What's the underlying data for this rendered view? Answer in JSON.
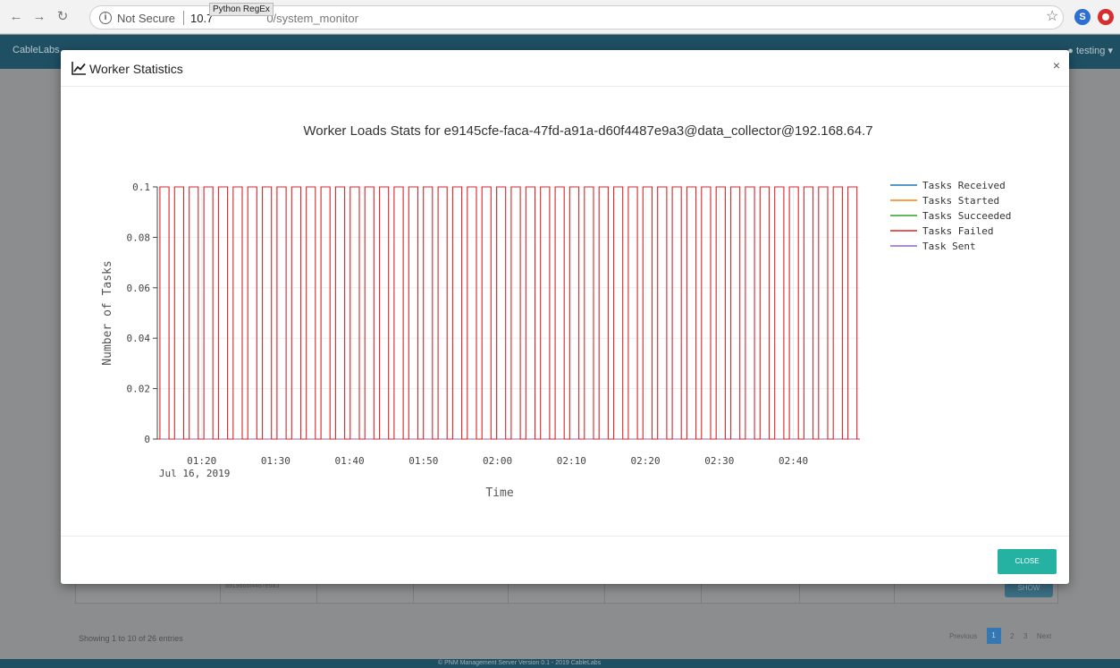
{
  "browser": {
    "not_secure": "Not Secure",
    "url_host": "10.7",
    "url_path": "0/system_monitor",
    "tooltip": "Python RegEx",
    "profile_initial": "S"
  },
  "app": {
    "logo": "CableLabs",
    "user": "testing",
    "table_cell": "a919d66f4487e9a3",
    "show_button": "SHOW",
    "entries_info": "Showing 1 to 10 of 26 entries",
    "pager": {
      "previous": "Previous",
      "pages": [
        "1",
        "2",
        "3"
      ],
      "next": "Next"
    },
    "footer": "© PNM Management Server Version 0.1 - 2019 CableLabs"
  },
  "modal": {
    "title": "Worker Statistics",
    "close_label": "CLOSE"
  },
  "chart_data": {
    "type": "line",
    "title": "Worker Loads Stats for e9145cfe-faca-47fd-a91a-d60f4487e9a3@data_collector@192.168.64.7",
    "xlabel": "Time",
    "ylabel": "Number of Tasks",
    "x_ticks": [
      "01:20",
      "01:30",
      "01:40",
      "01:50",
      "02:00",
      "02:10",
      "02:20",
      "02:30",
      "02:40"
    ],
    "x_tick_sublabel": "Jul 16, 2019",
    "x_range": [
      "01:14",
      "02:49"
    ],
    "y_ticks": [
      0,
      0.02,
      0.04,
      0.06,
      0.08,
      0.1
    ],
    "ylim": [
      0,
      0.1
    ],
    "grid": true,
    "legend_position": "right",
    "series": [
      {
        "name": "Tasks Received",
        "color": "#1f77b4",
        "values": "all 0"
      },
      {
        "name": "Tasks Started",
        "color": "#ff7f0e",
        "values": "all 0"
      },
      {
        "name": "Tasks Succeeded",
        "color": "#2ca02c",
        "values": "all 0"
      },
      {
        "name": "Tasks Failed",
        "color": "#d62728",
        "pulse_value": 0.1,
        "pulse_count": 48
      },
      {
        "name": "Task Sent",
        "color": "#9467bd",
        "values": "all 0"
      }
    ]
  }
}
